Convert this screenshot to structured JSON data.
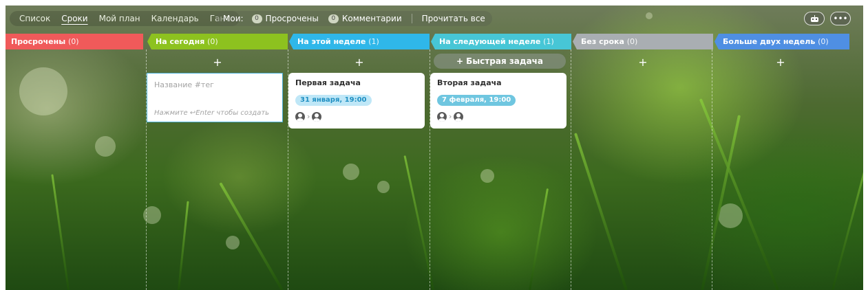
{
  "tabs": [
    {
      "label": "Список"
    },
    {
      "label": "Сроки"
    },
    {
      "label": "Мой план"
    },
    {
      "label": "Календарь"
    },
    {
      "label": "Гант"
    }
  ],
  "active_tab": "Сроки",
  "filters": {
    "label": "Мои:",
    "overdue": {
      "count": "0",
      "label": "Просрочены"
    },
    "comments": {
      "count": "0",
      "label": "Комментарии"
    },
    "read_all": "Прочитать все"
  },
  "toolbar_icons": {
    "bot": "robot-icon",
    "more": "more-icon",
    "more_glyph": "•••"
  },
  "columns": [
    {
      "title": "Просрочены",
      "count": "(0)",
      "color": "#f05a5a"
    },
    {
      "title": "На сегодня",
      "count": "(0)",
      "color": "#8dc21f"
    },
    {
      "title": "На этой неделе",
      "count": "(1)",
      "color": "#2fb7e9"
    },
    {
      "title": "На следующей неделе",
      "count": "(1)",
      "color": "#47c6d6"
    },
    {
      "title": "Без срока",
      "count": "(0)",
      "color": "#a9aeb2"
    },
    {
      "title": "Больше двух недель",
      "count": "(0)",
      "color": "#4f8fe3"
    }
  ],
  "add_symbol": "+",
  "quick_add": "+ Быстрая задача",
  "new_task": {
    "placeholder": "Название #тег",
    "hint": "Нажмите ↩Enter чтобы создать"
  },
  "tasks": [
    {
      "title": "Первая задача",
      "deadline": "31 января, 19:00"
    },
    {
      "title": "Вторая задача",
      "deadline": "7 февраля, 19:00"
    }
  ]
}
